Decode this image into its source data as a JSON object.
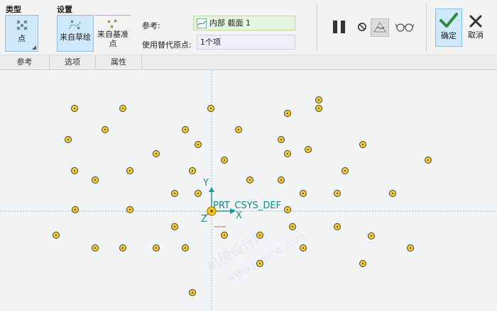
{
  "ribbon": {
    "type_group": "类型",
    "settings_group": "设置",
    "point_button": "点",
    "from_sketch_button": "来自草绘",
    "from_datum_button_line1": "来自基准",
    "from_datum_button_line2": "点",
    "reference_label": "参考:",
    "reference_value": "内部 截面 1",
    "alt_origin_label": "使用替代原点:",
    "alt_origin_value": "1个项",
    "ok_label": "确定",
    "cancel_label": "取消"
  },
  "tabs": [
    "参考",
    "选项",
    "属性"
  ],
  "canvas": {
    "csys_label": "PRT_CSYS_DEF",
    "axis_x": "X",
    "axis_y": "Y",
    "axis_z": "Z",
    "watermark_line1": "机械设计网",
    "watermark_line2": "www.jxzone.com"
  },
  "colors": {
    "accent": "#1a9c9c",
    "point_fill": "#f5cc2a",
    "active_button": "#cfe8fb",
    "ok_check": "#2e8b3a"
  },
  "icons": [
    "point-type-icon",
    "sketch-icon",
    "datum-point-icon",
    "sketch-ref-icon",
    "pause-icon",
    "no-entry-icon",
    "preview-icon",
    "glasses-icon",
    "checkmark-icon",
    "close-icon"
  ]
}
